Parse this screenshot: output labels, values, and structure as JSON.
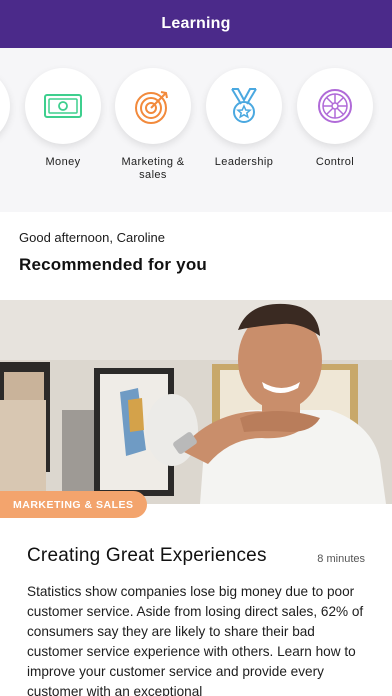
{
  "header": {
    "title": "Learning"
  },
  "categories": [
    {
      "label": "Money",
      "icon": "banknote-icon"
    },
    {
      "label": "Marketing &\nsales",
      "icon": "target-icon"
    },
    {
      "label": "Leadership",
      "icon": "medal-icon"
    },
    {
      "label": "Control",
      "icon": "wheel-icon"
    }
  ],
  "greeting": "Good afternoon, Caroline",
  "section_title": "Recommended for you",
  "card": {
    "badge": "MARKETING & SALES",
    "title": "Creating Great Experiences",
    "duration": "8 minutes",
    "description": "Statistics show companies lose big money due to poor customer service. Aside from losing direct sales, 62% of consumers say they are likely to share their bad customer service experience with others. Learn how to improve your customer service and provide every customer with an exceptional"
  },
  "colors": {
    "header_bg": "#4b2a8a",
    "badge_bg": "#f3a46d",
    "money_icon": "#3ecf8e",
    "marketing_icon": "#f28a3c",
    "leadership_icon": "#4aa8e0",
    "control_icon": "#b06ad8"
  }
}
